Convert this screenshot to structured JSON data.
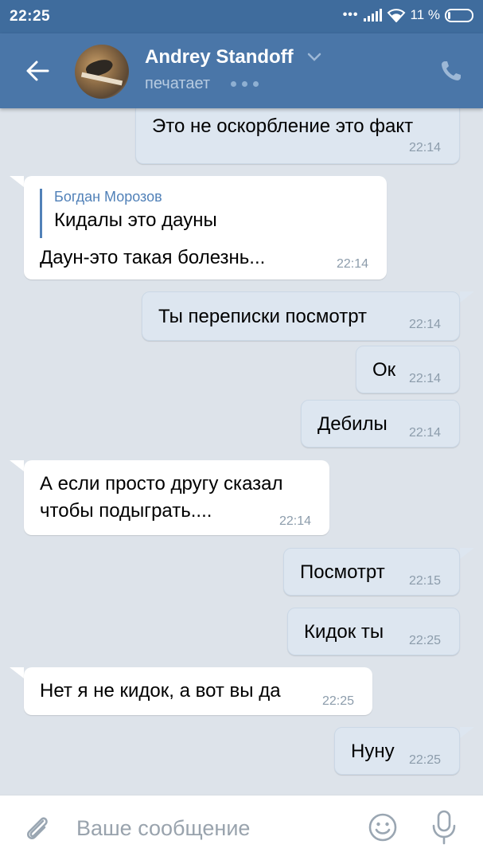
{
  "status_bar": {
    "time": "22:25",
    "dots": "•••",
    "battery_pct": "11 %"
  },
  "header": {
    "contact_name": "Andrey Standoff",
    "status": "печатает",
    "icons": [
      "back-arrow-icon",
      "chevron-down-icon",
      "phone-icon"
    ]
  },
  "messages": [
    {
      "dir": "out",
      "text": "Это не оскорбление это факт",
      "time": "22:14"
    },
    {
      "dir": "in",
      "reply_author": "Богдан Морозов",
      "reply_text": "Кидалы это дауны",
      "text": "Даун-это такая болезнь...",
      "time": "22:14"
    },
    {
      "dir": "out",
      "text": "Ты переписки посмотрт",
      "time": "22:14"
    },
    {
      "dir": "out",
      "text": "Ок",
      "time": "22:14"
    },
    {
      "dir": "out",
      "text": "Дебилы",
      "time": "22:14"
    },
    {
      "dir": "in",
      "text": "А если просто другу сказал",
      "text2": "чтобы подыграть....",
      "time": "22:14"
    },
    {
      "dir": "out",
      "text": "Посмотрт",
      "time": "22:15"
    },
    {
      "dir": "out",
      "text": "Кидок ты",
      "time": "22:25"
    },
    {
      "dir": "in",
      "text": "Нет я не кидок, а вот вы да",
      "time": "22:25"
    },
    {
      "dir": "out",
      "text": "Нуну",
      "time": "22:25"
    }
  ],
  "composer": {
    "placeholder": "Ваше сообщение",
    "icons": [
      "paperclip-icon",
      "smiley-icon",
      "microphone-icon"
    ]
  },
  "colors": {
    "header": "#4a76a8",
    "status_bar": "#3f6c9d",
    "background": "#dde3ea",
    "outgoing_bubble": "#dde6f0",
    "incoming_bubble": "#ffffff",
    "link": "#5181b8"
  }
}
